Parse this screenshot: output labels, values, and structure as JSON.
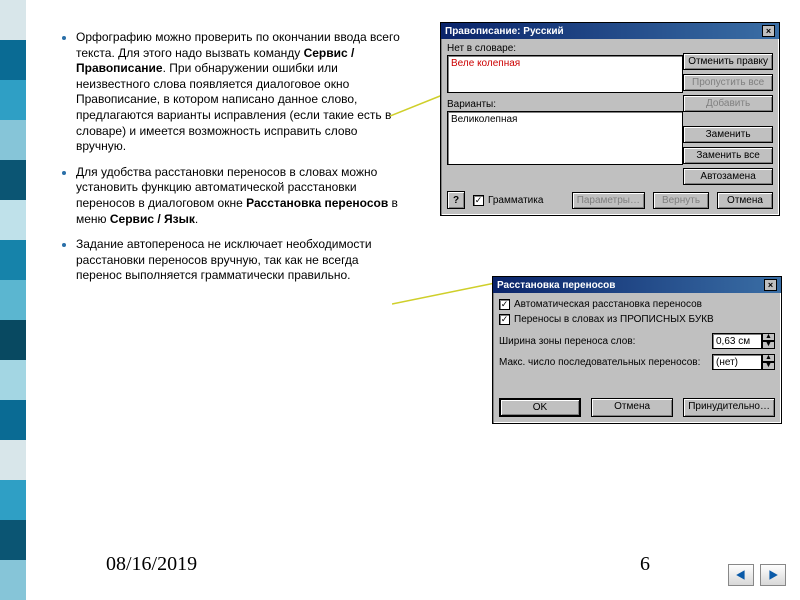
{
  "bullets": {
    "b1_pre": "Орфографию можно проверить по окончании ввода всего текста. Для этого надо вызвать команду ",
    "b1_bold": "Сервис / Правописание",
    "b1_post": ". При обнаружении ошибки или неизвестного слова появляется диалоговое окно Правописание, в котором написано данное слово, предлагаются варианты исправления (если такие есть в словаре) и имеется возможность исправить слово вручную.",
    "b2_pre": "Для удобства расстановки переносов в словах можно установить функцию автоматической расстановки переносов в диалоговом окне ",
    "b2_bold": "Расстановка переносов",
    "b2_mid": " в меню ",
    "b2_bold2": "Сервис / Язык",
    "b2_post": ".",
    "b3": "Задание автопереноса не исключает необходимости расстановки переносов вручную, так как не всегда перенос выполняется грамматически правильно."
  },
  "footer": {
    "date": "08/16/2019",
    "page": "6"
  },
  "dlg1": {
    "title": "Правописание: Русский",
    "label_not_in_dict": "Нет в словаре:",
    "word": "Веле колепная",
    "label_variants": "Варианты:",
    "variant": "Великолепная",
    "btn_undo": "Отменить правку",
    "btn_skip_all": "Пропустить все",
    "btn_add": "Добавить",
    "btn_replace": "Заменить",
    "btn_replace_all": "Заменить все",
    "btn_autocorrect": "Автозамена",
    "chk_grammar": "Грамматика",
    "btn_options": "Параметры…",
    "btn_revert": "Вернуть",
    "btn_cancel": "Отмена",
    "close": "×"
  },
  "dlg2": {
    "title": "Расстановка переносов",
    "chk_auto": "Автоматическая расстановка переносов",
    "chk_caps": "Переносы в словах из ПРОПИСНЫХ БУКВ",
    "label_width": "Ширина зоны переноса слов:",
    "val_width": "0,63 см",
    "label_max": "Макс. число последовательных переносов:",
    "val_max": "(нет)",
    "btn_ok": "OK",
    "btn_cancel": "Отмена",
    "btn_force": "Принудительно…",
    "close": "×"
  }
}
